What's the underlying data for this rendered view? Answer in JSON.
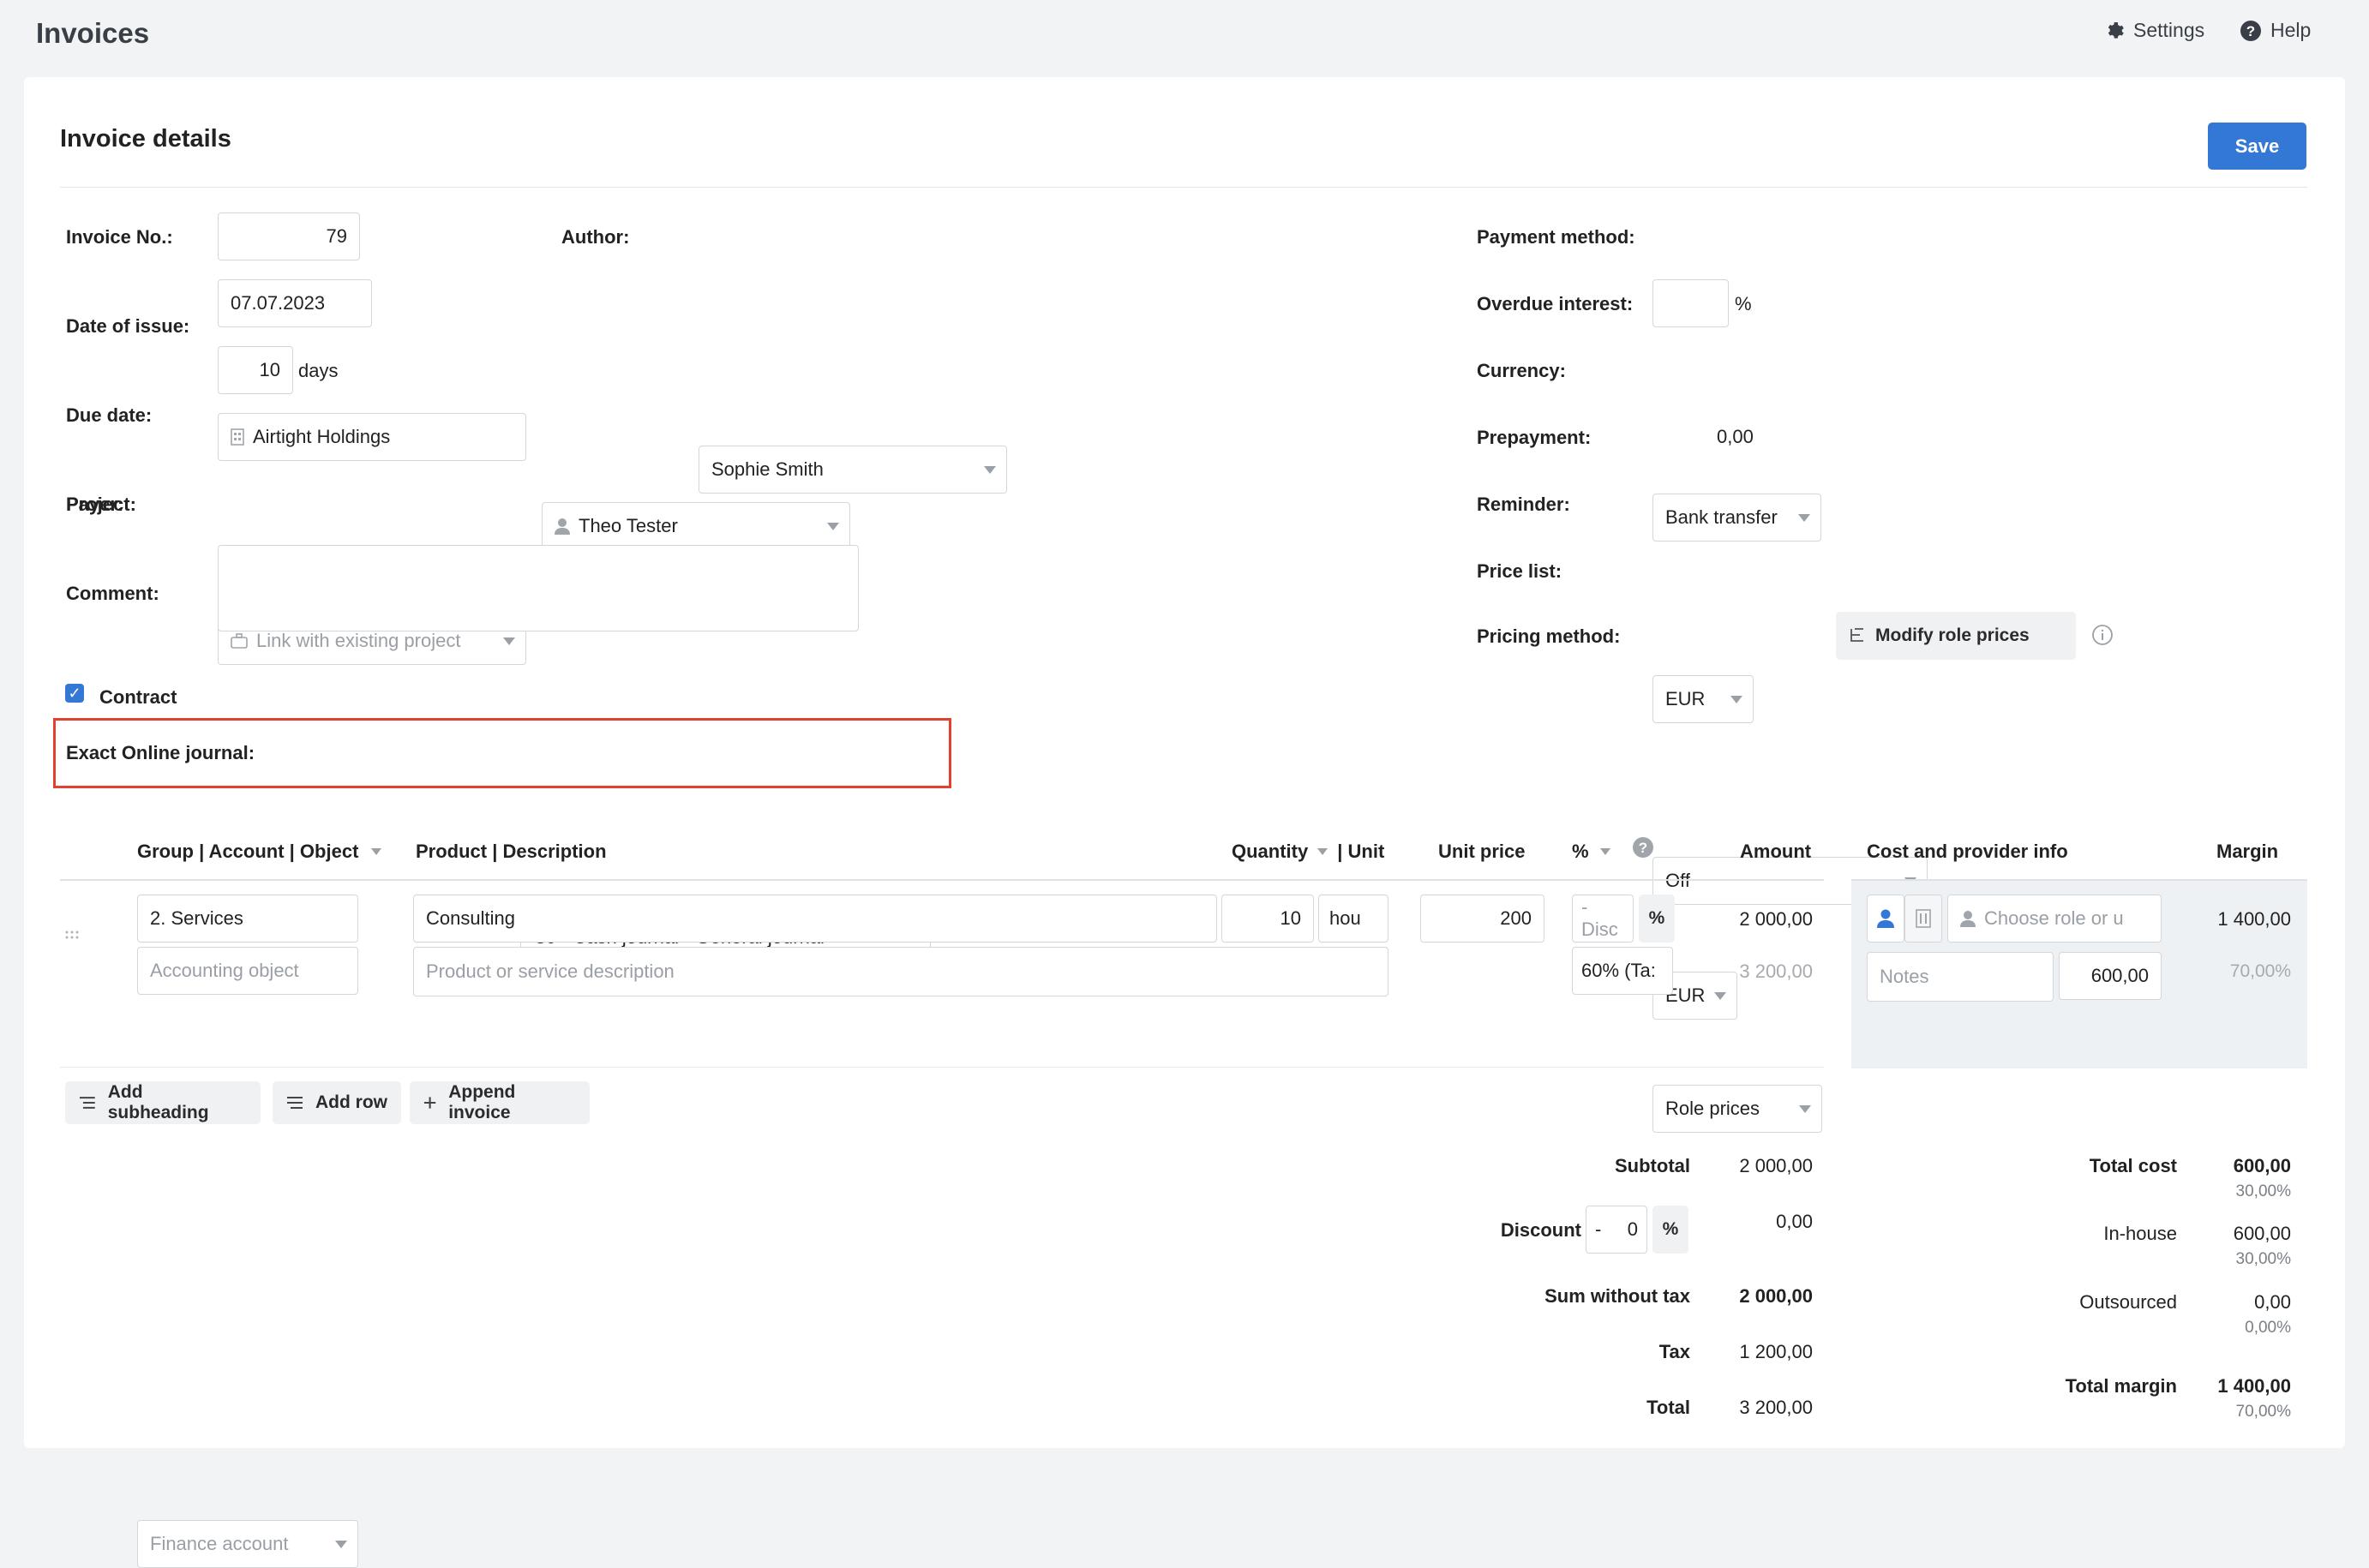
{
  "header": {
    "title": "Invoices",
    "settings_label": "Settings",
    "help_label": "Help"
  },
  "section": {
    "title": "Invoice details",
    "save_label": "Save"
  },
  "form": {
    "invoice_no_label": "Invoice No.:",
    "invoice_no": "79",
    "date_label": "Date of issue:",
    "date": "07.07.2023",
    "due_label": "Due date:",
    "due": "10",
    "due_unit": "days",
    "payer_label": "Payer:",
    "payer_company": "Airtight Holdings",
    "payer_person": "Theo Tester",
    "project_label": "Project:",
    "project_placeholder": "Link with existing project",
    "comment_label": "Comment:",
    "author_label": "Author:",
    "author": "Sophie Smith",
    "contract_label": "Contract",
    "contract_checked": true,
    "journal_label": "Exact Online journal:",
    "journal": "CJ - Cash journal - General journal",
    "payment_method_label": "Payment method:",
    "payment_method": "Bank transfer",
    "overdue_label": "Overdue interest:",
    "overdue_unit": "%",
    "currency_label": "Currency:",
    "currency": "EUR",
    "prepayment_label": "Prepayment:",
    "prepayment": "0,00",
    "reminder_label": "Reminder:",
    "reminder": "Off",
    "pricelist_label": "Price list:",
    "pricelist": "EUR",
    "pricing_label": "Pricing method:",
    "pricing": "Role prices",
    "modify_label": "Modify role prices"
  },
  "table": {
    "h_group": "Group | Account | Object",
    "h_product": "Product | Description",
    "h_quantity": "Quantity",
    "h_unit": "| Unit",
    "h_unit_price": "Unit price",
    "h_percent": "%",
    "h_amount": "Amount",
    "h_cost": "Cost and provider info",
    "h_margin": "Margin",
    "row": {
      "group": "2. Services",
      "accounting_placeholder": "Accounting object",
      "finance_placeholder": "Finance account",
      "product": "Consulting",
      "description_placeholder": "Product or service description",
      "quantity": "10",
      "unit": "hou",
      "unit_price": "200",
      "discount_placeholder": "-Disc",
      "percent_sign": "%",
      "tax": "60% (Ta:",
      "amount": "2 000,00",
      "amount_with_tax": "3 200,00",
      "role_placeholder": "Choose role or u",
      "notes_placeholder": "Notes",
      "cost": "600,00",
      "margin": "1 400,00",
      "margin_pct": "70,00%"
    }
  },
  "actions": {
    "add_subheading": "Add subheading",
    "add_row": "Add row",
    "append_invoice": "Append invoice"
  },
  "totals": {
    "subtotal_label": "Subtotal",
    "subtotal": "2 000,00",
    "discount_label": "Discount",
    "discount_sign": "-",
    "discount_value": "0",
    "discount_unit": "%",
    "discount_amount": "0,00",
    "sum_label": "Sum without tax",
    "sum": "2 000,00",
    "tax_label": "Tax",
    "tax": "1 200,00",
    "total_label": "Total",
    "total": "3 200,00"
  },
  "cost_totals": {
    "total_cost_label": "Total cost",
    "total_cost": "600,00",
    "total_cost_pct": "30,00%",
    "inhouse_label": "In-house",
    "inhouse": "600,00",
    "inhouse_pct": "30,00%",
    "outsourced_label": "Outsourced",
    "outsourced": "0,00",
    "outsourced_pct": "0,00%",
    "margin_label": "Total margin",
    "margin": "1 400,00",
    "margin_pct": "70,00%"
  }
}
